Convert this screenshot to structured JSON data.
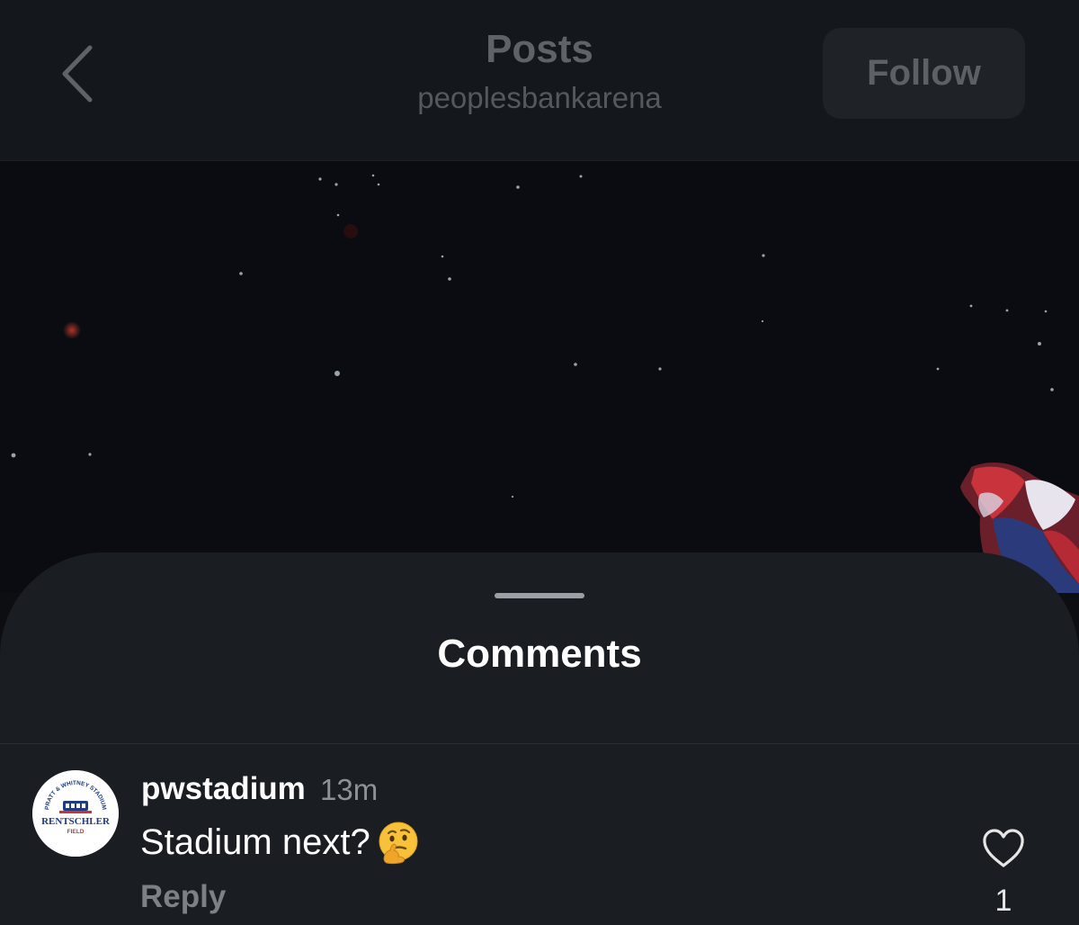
{
  "header": {
    "title": "Posts",
    "subtitle": "peoplesbankarena",
    "follow_label": "Follow",
    "back_icon": "chevron-left-icon"
  },
  "comments_sheet": {
    "title": "Comments",
    "comments": [
      {
        "username": "pwstadium",
        "time": "13m",
        "text": "Stadium next?",
        "emoji": "thinking-face-icon",
        "reply_label": "Reply",
        "like_count": "1",
        "avatar": {
          "arc_text": "PRATT & WHITNEY STADIUM",
          "name_text": "RENTSCHLER",
          "sub_text": "FIELD"
        }
      }
    ]
  },
  "colors": {
    "background": "#0c0e12",
    "header": "#14171b",
    "sheet": "#1a1d21",
    "text_primary": "#ffffff",
    "text_muted": "#8e9297"
  }
}
